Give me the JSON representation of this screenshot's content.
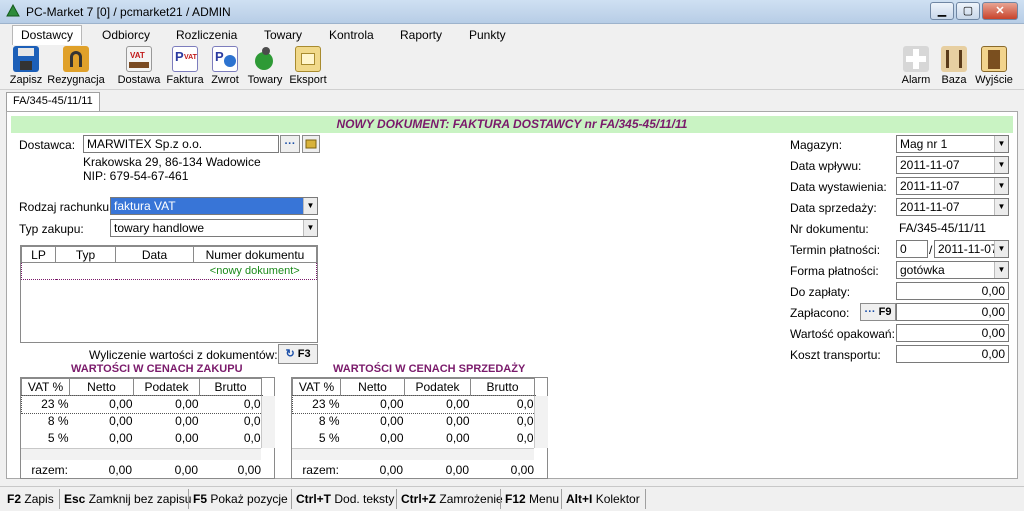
{
  "window": {
    "title": "PC-Market 7 [0] / pcmarket21 / ADMIN"
  },
  "menu": [
    {
      "label": "Dostawcy"
    },
    {
      "label": "Odbiorcy"
    },
    {
      "label": "Rozliczenia"
    },
    {
      "label": "Towary"
    },
    {
      "label": "Kontrola"
    },
    {
      "label": "Raporty"
    },
    {
      "label": "Punkty"
    }
  ],
  "toolbar": {
    "save": "Zapisz",
    "cancel": "Rezygnacja",
    "delivery": "Dostawa",
    "invoice": "Faktura",
    "return": "Zwrot",
    "goods": "Towary",
    "export": "Eksport",
    "alarm": "Alarm",
    "base": "Baza",
    "exit": "Wyjście"
  },
  "doc_tab": "FA/345-45/11/11",
  "banner": "NOWY DOKUMENT: FAKTURA DOSTAWCY nr FA/345-45/11/11",
  "supplier": {
    "label": "Dostawca:",
    "name": "MARWITEX Sp.z o.o.",
    "address": "Krakowska 29, 86-134 Wadowice",
    "nip": "NIP: 679-54-67-461",
    "dots": "···"
  },
  "account_type": {
    "label": "Rodzaj rachunku:",
    "value": "faktura VAT"
  },
  "purchase_type": {
    "label": "Typ zakupu:",
    "value": "towary handlowe"
  },
  "docs_table": {
    "headers": [
      "LP",
      "Typ",
      "Data",
      "Numer dokumentu"
    ],
    "new_row": "<nowy dokument>"
  },
  "calc": {
    "label": "Wyliczenie wartości z dokumentów:",
    "key": "F3"
  },
  "purchase_values": {
    "title": "WARTOŚCI W CENACH ZAKUPU",
    "headers": [
      "VAT %",
      "Netto",
      "Podatek",
      "Brutto"
    ],
    "rows": [
      [
        "23 %",
        "0,00",
        "0,00",
        "0,0"
      ],
      [
        "8 %",
        "0,00",
        "0,00",
        "0,0"
      ],
      [
        "5 %",
        "0,00",
        "0,00",
        "0,0"
      ]
    ],
    "total_label": "razem:",
    "totals": [
      "0,00",
      "0,00",
      "0,00"
    ]
  },
  "sale_values": {
    "title": "WARTOŚCI W CENACH SPRZEDAŻY",
    "headers": [
      "VAT %",
      "Netto",
      "Podatek",
      "Brutto"
    ],
    "rows": [
      [
        "23 %",
        "0,00",
        "0,00",
        "0,0"
      ],
      [
        "8 %",
        "0,00",
        "0,00",
        "0,0"
      ],
      [
        "5 %",
        "0,00",
        "0,00",
        "0,0"
      ]
    ],
    "total_label": "razem:",
    "totals": [
      "0,00",
      "0,00",
      "0,00"
    ]
  },
  "right_form": {
    "warehouse": {
      "label": "Magazyn:",
      "value": "Mag nr 1"
    },
    "receipt_date": {
      "label": "Data wpływu:",
      "value": "2011-11-07"
    },
    "issue_date": {
      "label": "Data wystawienia:",
      "value": "2011-11-07"
    },
    "sale_date": {
      "label": "Data sprzedaży:",
      "value": "2011-11-07"
    },
    "doc_number": {
      "label": "Nr dokumentu:",
      "value": "FA/345-45/11/11"
    },
    "payment_term": {
      "label": "Termin płatności:",
      "days": "0",
      "slash": "/",
      "date": "2011-11-07"
    },
    "payment_form": {
      "label": "Forma płatności:",
      "value": "gotówka"
    },
    "to_pay": {
      "label": "Do zapłaty:",
      "value": "0,00"
    },
    "paid": {
      "label": "Zapłacono:",
      "key": "F9",
      "value": "0,00"
    },
    "packaging": {
      "label": "Wartość opakowań:",
      "value": "0,00"
    },
    "transport": {
      "label": "Koszt transportu:",
      "value": "0,00"
    }
  },
  "statusbar": [
    {
      "key": "F2",
      "text": "Zapis"
    },
    {
      "key": "Esc",
      "text": "Zamknij bez zapisu"
    },
    {
      "key": "F5",
      "text": "Pokaż pozycje"
    },
    {
      "key": "Ctrl+T",
      "text": "Dod. teksty"
    },
    {
      "key": "Ctrl+Z",
      "text": "Zamrożenie"
    },
    {
      "key": "F12",
      "text": "Menu"
    },
    {
      "key": "Alt+I",
      "text": "Kolektor"
    }
  ],
  "colors": {
    "banner_bg": "#c9f3c3",
    "banner_text": "#7a1a6b",
    "selection": "#3875d7",
    "new_doc_text": "#1a8a1a"
  },
  "icons": [
    "app-icon",
    "save-icon",
    "cancel-icon",
    "delivery-icon",
    "invoice-icon",
    "return-icon",
    "goods-icon",
    "export-icon",
    "alarm-icon",
    "base-icon",
    "exit-icon"
  ]
}
